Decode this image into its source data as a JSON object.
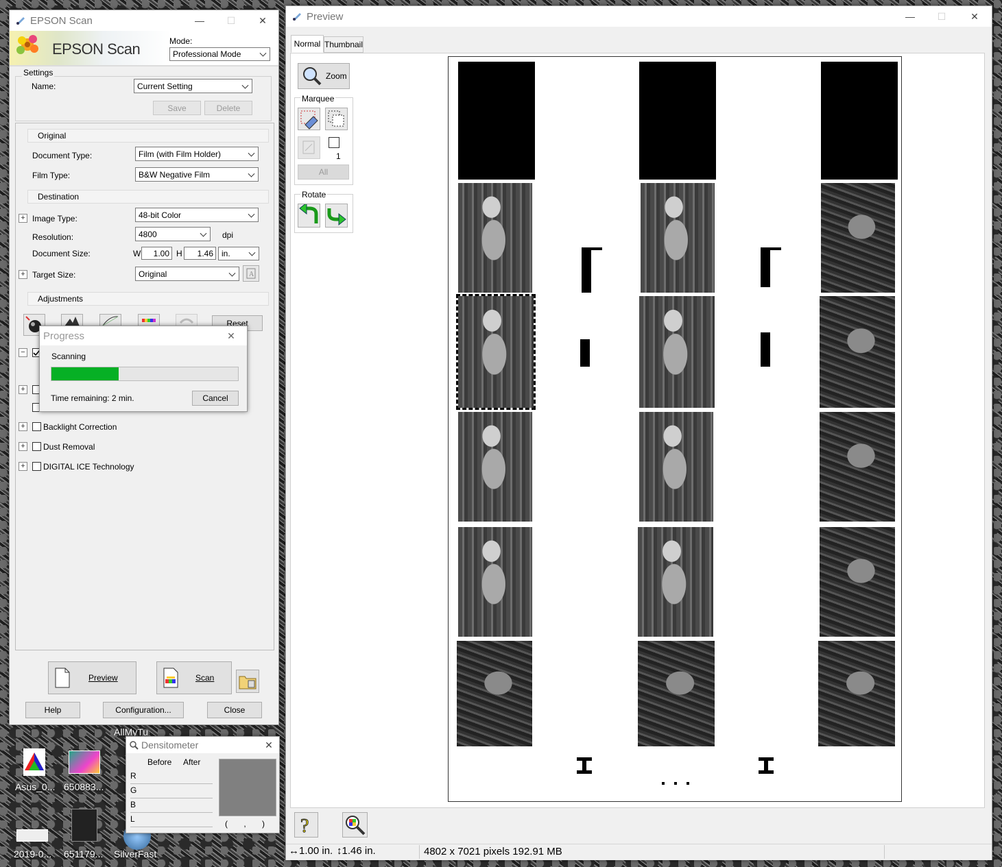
{
  "desktop": {
    "icons": [
      {
        "label": "Asus_0..."
      },
      {
        "label": "650883..."
      },
      {
        "label": "2019-0..."
      },
      {
        "label": "651179..."
      },
      {
        "label": "SilverFast"
      }
    ],
    "behind_label": "AllMyTu"
  },
  "epson": {
    "title": "EPSON Scan",
    "logo_text": "EPSON Scan",
    "mode_label": "Mode:",
    "mode_value": "Professional Mode",
    "settings": {
      "legend": "Settings",
      "name_label": "Name:",
      "name_value": "Current Setting",
      "save": "Save",
      "delete": "Delete"
    },
    "original": {
      "header": "Original",
      "doc_type_label": "Document Type:",
      "doc_type_value": "Film (with Film Holder)",
      "film_type_label": "Film Type:",
      "film_type_value": "B&W Negative Film"
    },
    "destination": {
      "header": "Destination",
      "image_type_label": "Image Type:",
      "image_type_value": "48-bit Color",
      "resolution_label": "Resolution:",
      "resolution_value": "4800",
      "resolution_unit": "dpi",
      "doc_size_label": "Document Size:",
      "w_label": "W",
      "w_value": "1.00",
      "h_label": "H",
      "h_value": "1.46",
      "size_unit": "in.",
      "target_size_label": "Target Size:",
      "target_size_value": "Original"
    },
    "adjustments": {
      "header": "Adjustments",
      "reset": "Reset",
      "backlight": "Backlight Correction",
      "dust": "Dust Removal",
      "ice": "DIGITAL ICE Technology"
    },
    "preview": "Preview",
    "scan": "Scan",
    "help": "Help",
    "configuration": "Configuration...",
    "close": "Close"
  },
  "progress": {
    "title": "Progress",
    "status": "Scanning",
    "percent": 36,
    "time_remaining": "Time remaining: 2 min.",
    "cancel": "Cancel",
    "bar_color": "#06b025"
  },
  "densitometer": {
    "title": "Densitometer",
    "before": "Before",
    "after": "After",
    "rows": [
      "R",
      "G",
      "B",
      "L"
    ],
    "coords": "(  ,  )"
  },
  "previewwin": {
    "title": "Preview",
    "tabs": [
      "Normal",
      "Thumbnail"
    ],
    "zoom": "Zoom",
    "marquee_legend": "Marquee",
    "marquee_count": "1",
    "all": "All",
    "rotate_legend": "Rotate",
    "status_width": "1.00 in.",
    "status_height": "1.46 in.",
    "status_pixels": "4802 x 7021 pixels 192.91 MB"
  }
}
